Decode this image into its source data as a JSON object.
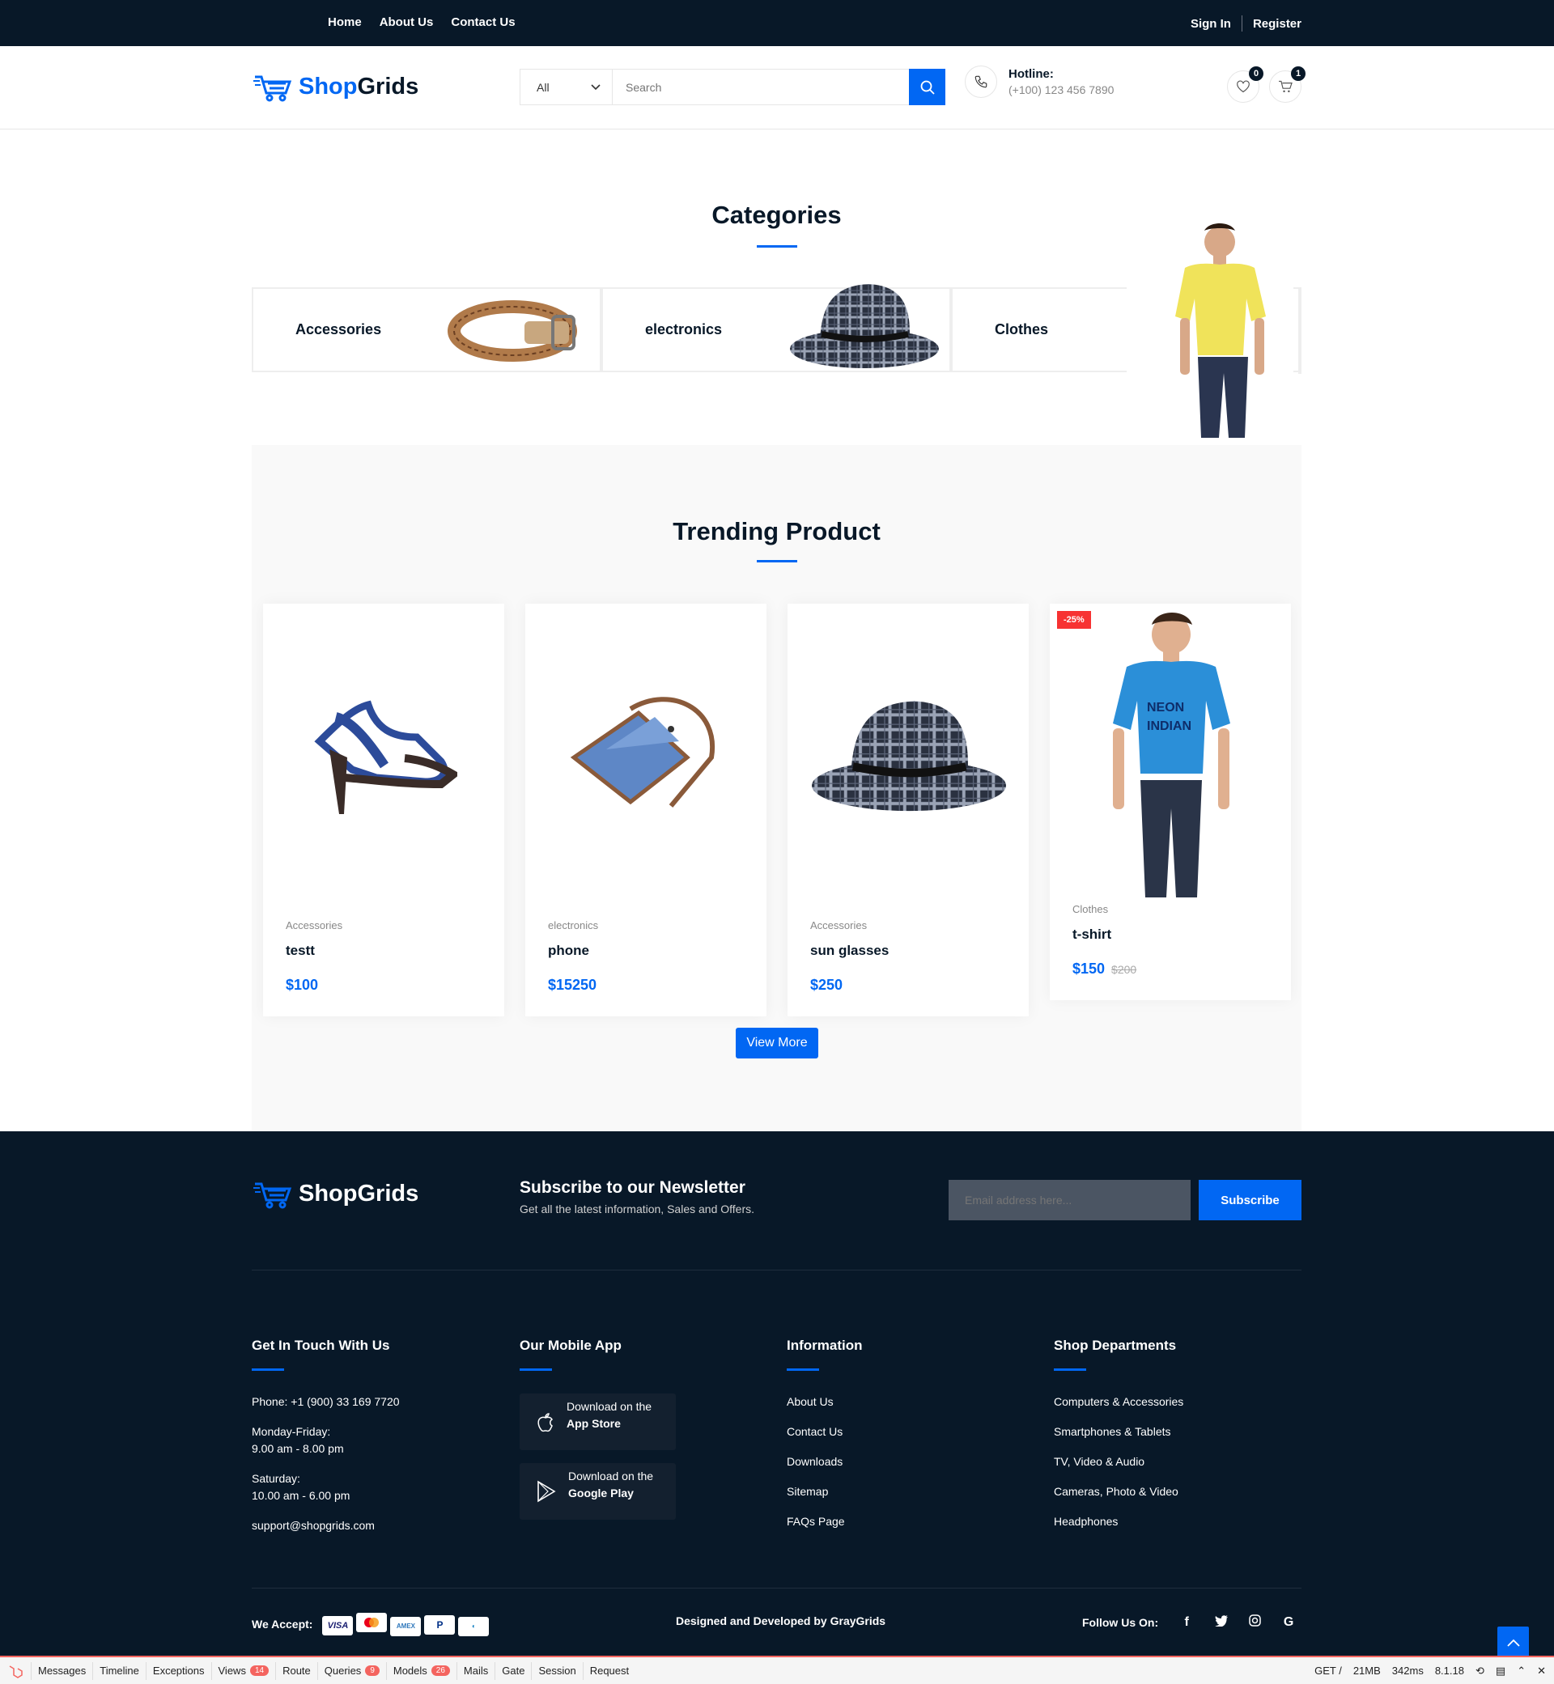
{
  "topbar": {
    "nav": [
      "Home",
      "About Us",
      "Contact Us"
    ],
    "sign_in": "Sign In",
    "register": "Register"
  },
  "header": {
    "logo_part1": "Shop",
    "logo_part2": "Grids",
    "category_select": "All",
    "search_placeholder": "Search",
    "hotline_label": "Hotline:",
    "hotline_number": "(+100) 123 456 7890",
    "wishlist_count": "0",
    "cart_count": "1"
  },
  "categories": {
    "title": "Categories",
    "items": [
      "Accessories",
      "electronics",
      "Clothes"
    ]
  },
  "trending": {
    "title": "Trending Product",
    "products": [
      {
        "category": "Accessories",
        "name": "testt",
        "price": "$100"
      },
      {
        "category": "electronics",
        "name": "phone",
        "price": "$15250"
      },
      {
        "category": "Accessories",
        "name": "sun glasses",
        "price": "$250"
      },
      {
        "category": "Clothes",
        "name": "t-shirt",
        "price": "$150",
        "old_price": "$200",
        "sale": "-25%"
      }
    ],
    "view_more": "View More"
  },
  "footer": {
    "logo": "ShopGrids",
    "newsletter_title": "Subscribe to our Newsletter",
    "newsletter_sub": "Get all the latest information, Sales and Offers.",
    "email_placeholder": "Email address here...",
    "subscribe": "Subscribe",
    "contact": {
      "title": "Get In Touch With Us",
      "phone": "Phone: +1 (900) 33 169 7720",
      "hours1_label": "Monday-Friday:",
      "hours1": "9.00 am - 8.00 pm",
      "hours2_label": "Saturday:",
      "hours2": "10.00 am - 6.00 pm",
      "email": "support@shopgrids.com"
    },
    "app": {
      "title": "Our Mobile App",
      "store1_top": "Download on the",
      "store1": "App Store",
      "store2_top": "Download on the",
      "store2": "Google Play"
    },
    "info": {
      "title": "Information",
      "links": [
        "About Us",
        "Contact Us",
        "Downloads",
        "Sitemap",
        "FAQs Page"
      ]
    },
    "departments": {
      "title": "Shop Departments",
      "links": [
        "Computers & Accessories",
        "Smartphones & Tablets",
        "TV, Video & Audio",
        "Cameras, Photo & Video",
        "Headphones"
      ]
    },
    "we_accept": "We Accept:",
    "cards": [
      "VISA",
      "MC",
      "AMEX",
      "PP",
      "DC"
    ],
    "designed": "Designed and Developed by GrayGrids",
    "follow": "Follow Us On:",
    "social": [
      "f",
      "t",
      "ig",
      "G"
    ]
  },
  "debugbar": {
    "items": [
      "Messages",
      "Timeline",
      "Exceptions",
      "Views",
      "Route",
      "Queries",
      "Models",
      "Mails",
      "Gate",
      "Session",
      "Request"
    ],
    "views_count": "14",
    "queries_count": "9",
    "models_count": "26",
    "method": "GET /",
    "memory": "21MB",
    "time": "342ms",
    "version": "8.1.18"
  },
  "colors": {
    "primary": "#0167F3",
    "dark": "#081828",
    "sale": "#F73232"
  }
}
